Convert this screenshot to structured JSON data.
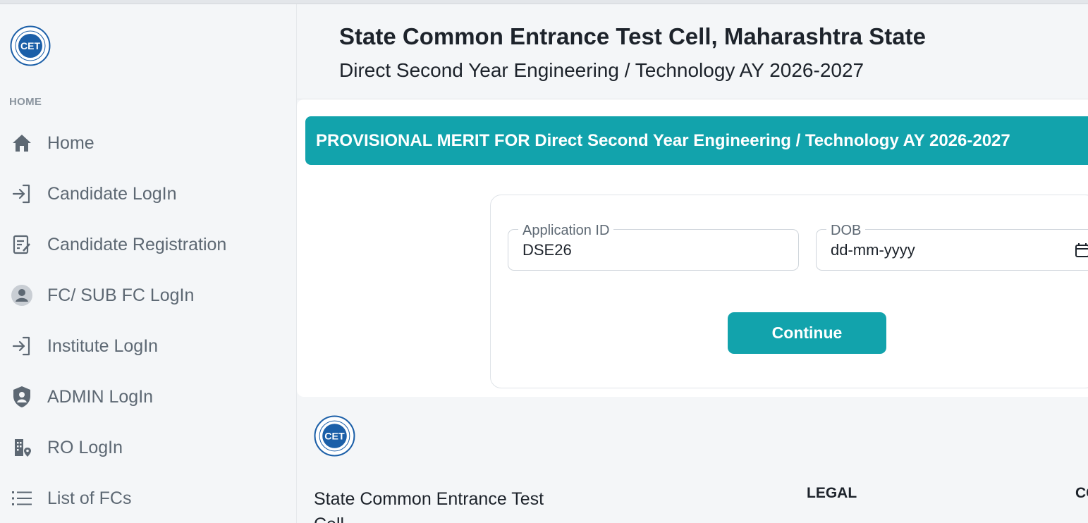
{
  "header": {
    "title": "State Common Entrance Test Cell, Maharashtra State",
    "subtitle": "Direct Second Year Engineering / Technology AY 2026-2027"
  },
  "sidebar": {
    "section_caption": "HOME",
    "items": [
      {
        "label": "Home",
        "icon": "home-icon"
      },
      {
        "label": "Candidate LogIn",
        "icon": "login-icon"
      },
      {
        "label": "Candidate Registration",
        "icon": "registration-icon"
      },
      {
        "label": "FC/ SUB FC LogIn",
        "icon": "user-circle-icon"
      },
      {
        "label": "Institute LogIn",
        "icon": "login-icon"
      },
      {
        "label": "ADMIN LogIn",
        "icon": "shield-user-icon"
      },
      {
        "label": "RO LogIn",
        "icon": "building-location-icon"
      },
      {
        "label": "List of FCs",
        "icon": "list-icon"
      }
    ]
  },
  "main": {
    "banner_text": "PROVISIONAL MERIT FOR Direct Second Year Engineering / Technology AY 2026-2027",
    "form": {
      "application_id_label": "Application ID",
      "application_id_value": "DSE26",
      "dob_label": "DOB",
      "dob_placeholder": "dd-mm-yyyy",
      "continue_label": "Continue"
    }
  },
  "footer": {
    "org_text": "State Common Entrance Test Cell",
    "legal_heading": "LEGAL",
    "contact_heading_partial": "CO"
  },
  "colors": {
    "accent": "#12a3ac",
    "sidebar_text": "#5d6873",
    "logo_blue": "#1b5fa8"
  }
}
